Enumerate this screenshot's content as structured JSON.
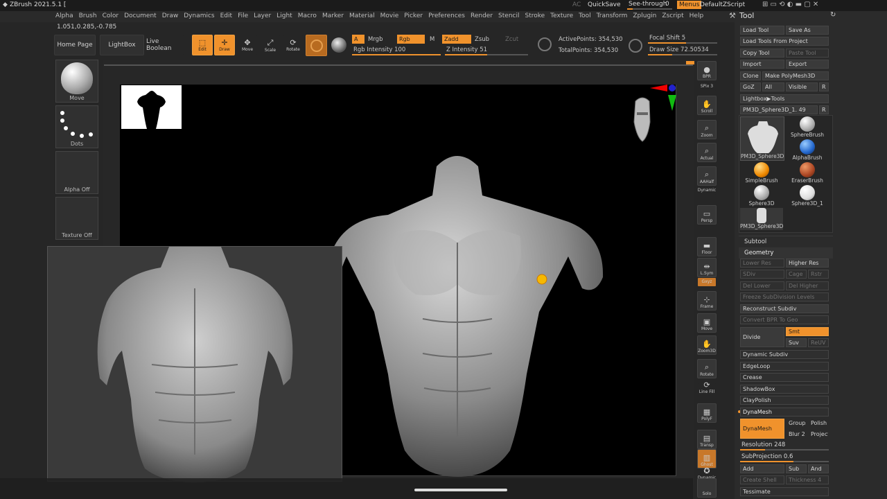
{
  "app": {
    "title": "ZBrush 2021.5.1 [",
    "ac": "AC",
    "quicksave": "QuickSave",
    "see_through_label": "See-through",
    "see_through_value": "0",
    "menus": "Menus",
    "script": "DefaultZScript"
  },
  "menus": [
    "Alpha",
    "Brush",
    "Color",
    "Document",
    "Draw",
    "Dynamics",
    "Edit",
    "File",
    "Layer",
    "Light",
    "Macro",
    "Marker",
    "Material",
    "Movie",
    "Picker",
    "Preferences",
    "Render",
    "Stencil",
    "Stroke",
    "Texture",
    "Tool",
    "Transform",
    "Zplugin",
    "Zscript",
    "Help"
  ],
  "coords": "1.051,0.285,-0.785",
  "toolbar": {
    "home_page": "Home Page",
    "lightbox": "LightBox",
    "live_boolean": "Live Boolean",
    "edit": "Edit",
    "draw": "Draw",
    "move": "Move",
    "scale": "Scale",
    "rotate": "Rotate",
    "a": "A",
    "mrgb": "Mrgb",
    "rgb": "Rgb",
    "m": "M",
    "zadd": "Zadd",
    "zsub": "Zsub",
    "zcut": "Zcut",
    "rgb_intensity": "Rgb Intensity 100",
    "z_intensity": "Z Intensity 51",
    "active_points": "ActivePoints: 354,530",
    "total_points": "TotalPoints: 354,530",
    "focal_shift": "Focal Shift 5",
    "draw_size": "Draw Size 72.50534"
  },
  "left": {
    "move": "Move",
    "dots": "Dots",
    "alpha_off": "Alpha Off",
    "texture_off": "Texture Off"
  },
  "right_shelf": [
    "BPR",
    "SPix 3",
    "Scroll",
    "Zoom",
    "Actual",
    "AAHalf",
    "Dynamic",
    "Persp",
    "Floor",
    "L.Sym",
    "Gxyz",
    "Frame",
    "Move",
    "Zoom3D",
    "Rotate",
    "Line Fill",
    "PolyF",
    "Transp",
    "Ghost",
    "Dynamic",
    "Solo"
  ],
  "tool": {
    "title": "Tool",
    "load_tool": "Load Tool",
    "save_as": "Save As",
    "load_from_project": "Load Tools From Project",
    "copy_tool": "Copy Tool",
    "paste_tool": "Paste Tool",
    "import": "Import",
    "export": "Export",
    "clone": "Clone",
    "make_polymesh": "Make PolyMesh3D",
    "goz": "GoZ",
    "all": "All",
    "visible": "Visible",
    "r": "R",
    "lightbox_tools": "Lightbox▶Tools",
    "current_tool": "PM3D_Sphere3D_1. 49",
    "tools": [
      "PM3D_Sphere3D",
      "SphereBrush",
      "AlphaBrush",
      "SimpleBrush",
      "EraserBrush",
      "Sphere3D",
      "Sphere3D_1",
      "PM3D_Sphere3D"
    ],
    "subtool": "Subtool",
    "geometry": "Geometry",
    "lower_res": "Lower Res",
    "higher_res": "Higher Res",
    "sdiv": "SDiv",
    "cage": "Cage",
    "rstr": "Rstr",
    "del_lower": "Del Lower",
    "del_higher": "Del Higher",
    "freeze": "Freeze SubDivision Levels",
    "reconstruct": "Reconstruct Subdiv",
    "convert_bpr": "Convert BPR To Geo",
    "divide": "Divide",
    "smt": "Smt",
    "suv": "Suv",
    "reuv": "ReUV",
    "dynamic_subdiv": "Dynamic Subdiv",
    "edgeloop": "EdgeLoop",
    "crease": "Crease",
    "shadowbox": "ShadowBox",
    "claypolish": "ClayPolish",
    "dynamesh_header": "DynaMesh",
    "dynamesh": "DynaMesh",
    "groups": "Groups",
    "polish": "Polish",
    "blur": "Blur 2",
    "project": "Project",
    "resolution": "Resolution 248",
    "subprojection": "SubProjection 0.6",
    "add": "Add",
    "sub": "Sub",
    "and": "And",
    "create_shell": "Create Shell",
    "thickness": "Thickness 4",
    "tessimate": "Tessimate"
  },
  "colors": {
    "accent": "#f0922c",
    "panel": "#2b2b2b",
    "canvas": "#000000"
  }
}
